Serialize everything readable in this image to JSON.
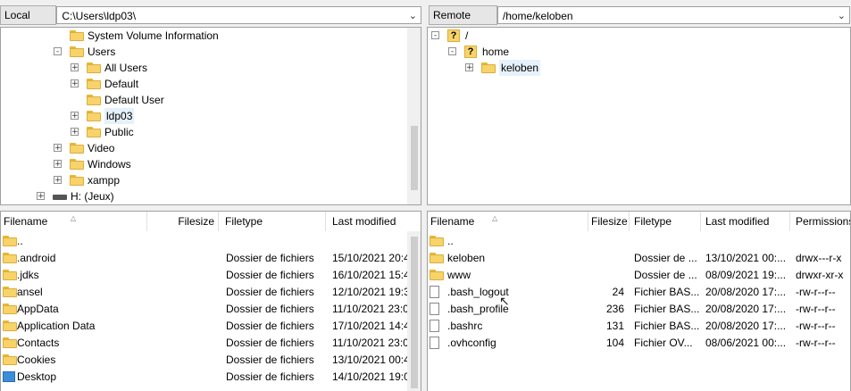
{
  "local": {
    "label": "Local site:",
    "path": "C:\\Users\\ldp03\\",
    "tree": [
      {
        "name": "System Volume Information",
        "indent": 3,
        "expander": false,
        "icon": "folder"
      },
      {
        "name": "Users",
        "indent": 3,
        "expander": "-",
        "icon": "folder"
      },
      {
        "name": "All Users",
        "indent": 4,
        "expander": "+",
        "icon": "folder"
      },
      {
        "name": "Default",
        "indent": 4,
        "expander": "+",
        "icon": "folder"
      },
      {
        "name": "Default User",
        "indent": 4,
        "expander": false,
        "icon": "folder"
      },
      {
        "name": "ldp03",
        "indent": 4,
        "expander": "+",
        "icon": "folder",
        "selected": true
      },
      {
        "name": "Public",
        "indent": 4,
        "expander": "+",
        "icon": "folder"
      },
      {
        "name": "Video",
        "indent": 3,
        "expander": "+",
        "icon": "folder"
      },
      {
        "name": "Windows",
        "indent": 3,
        "expander": "+",
        "icon": "folder"
      },
      {
        "name": "xampp",
        "indent": 3,
        "expander": "+",
        "icon": "folder"
      },
      {
        "name": "H: (Jeux)",
        "indent": 2,
        "expander": "+",
        "icon": "drive"
      }
    ],
    "columns": {
      "filename": "Filename",
      "filesize": "Filesize",
      "filetype": "Filetype",
      "modified": "Last modified"
    },
    "files": [
      {
        "name": "..",
        "size": "",
        "type": "",
        "modified": "",
        "icon": "folder"
      },
      {
        "name": ".android",
        "size": "",
        "type": "Dossier de fichiers",
        "modified": "15/10/2021 20:4",
        "icon": "folder"
      },
      {
        "name": ".jdks",
        "size": "",
        "type": "Dossier de fichiers",
        "modified": "16/10/2021 15:4",
        "icon": "folder"
      },
      {
        "name": "ansel",
        "size": "",
        "type": "Dossier de fichiers",
        "modified": "12/10/2021 19:3",
        "icon": "folder"
      },
      {
        "name": "AppData",
        "size": "",
        "type": "Dossier de fichiers",
        "modified": "11/10/2021 23:0",
        "icon": "folder"
      },
      {
        "name": "Application Data",
        "size": "",
        "type": "Dossier de fichiers",
        "modified": "17/10/2021 14:4",
        "icon": "folder"
      },
      {
        "name": "Contacts",
        "size": "",
        "type": "Dossier de fichiers",
        "modified": "11/10/2021 23:0",
        "icon": "folder"
      },
      {
        "name": "Cookies",
        "size": "",
        "type": "Dossier de fichiers",
        "modified": "13/10/2021 00:4",
        "icon": "folder"
      },
      {
        "name": "Desktop",
        "size": "",
        "type": "Dossier de fichiers",
        "modified": "14/10/2021 19:0",
        "icon": "desktop"
      }
    ]
  },
  "remote": {
    "label": "Remote site:",
    "path": "/home/keloben",
    "tree": [
      {
        "name": "/",
        "indent": 0,
        "expander": "-",
        "icon": "question"
      },
      {
        "name": "home",
        "indent": 1,
        "expander": "-",
        "icon": "question"
      },
      {
        "name": "keloben",
        "indent": 2,
        "expander": "+",
        "icon": "folder",
        "selected": true
      }
    ],
    "columns": {
      "filename": "Filename",
      "filesize": "Filesize",
      "filetype": "Filetype",
      "modified": "Last modified",
      "permissions": "Permissions"
    },
    "files": [
      {
        "name": "..",
        "size": "",
        "type": "",
        "modified": "",
        "perms": "",
        "icon": "folder"
      },
      {
        "name": "keloben",
        "size": "",
        "type": "Dossier de ...",
        "modified": "13/10/2021 00:...",
        "perms": "drwx---r-x",
        "icon": "folder"
      },
      {
        "name": "www",
        "size": "",
        "type": "Dossier de ...",
        "modified": "08/09/2021 19:...",
        "perms": "drwxr-xr-x",
        "icon": "folder"
      },
      {
        "name": ".bash_logout",
        "size": "24",
        "type": "Fichier BAS...",
        "modified": "20/08/2020 17:...",
        "perms": "-rw-r--r--",
        "icon": "file"
      },
      {
        "name": ".bash_profile",
        "size": "236",
        "type": "Fichier BAS...",
        "modified": "20/08/2020 17:...",
        "perms": "-rw-r--r--",
        "icon": "file"
      },
      {
        "name": ".bashrc",
        "size": "131",
        "type": "Fichier BAS...",
        "modified": "20/08/2020 17:...",
        "perms": "-rw-r--r--",
        "icon": "file"
      },
      {
        "name": ".ovhconfig",
        "size": "104",
        "type": "Fichier OV...",
        "modified": "08/06/2021 00:...",
        "perms": "-rw-r--r--",
        "icon": "file"
      }
    ]
  },
  "icons": {
    "dropdown": "chevron-down-icon",
    "sort": "sort-up-icon"
  }
}
